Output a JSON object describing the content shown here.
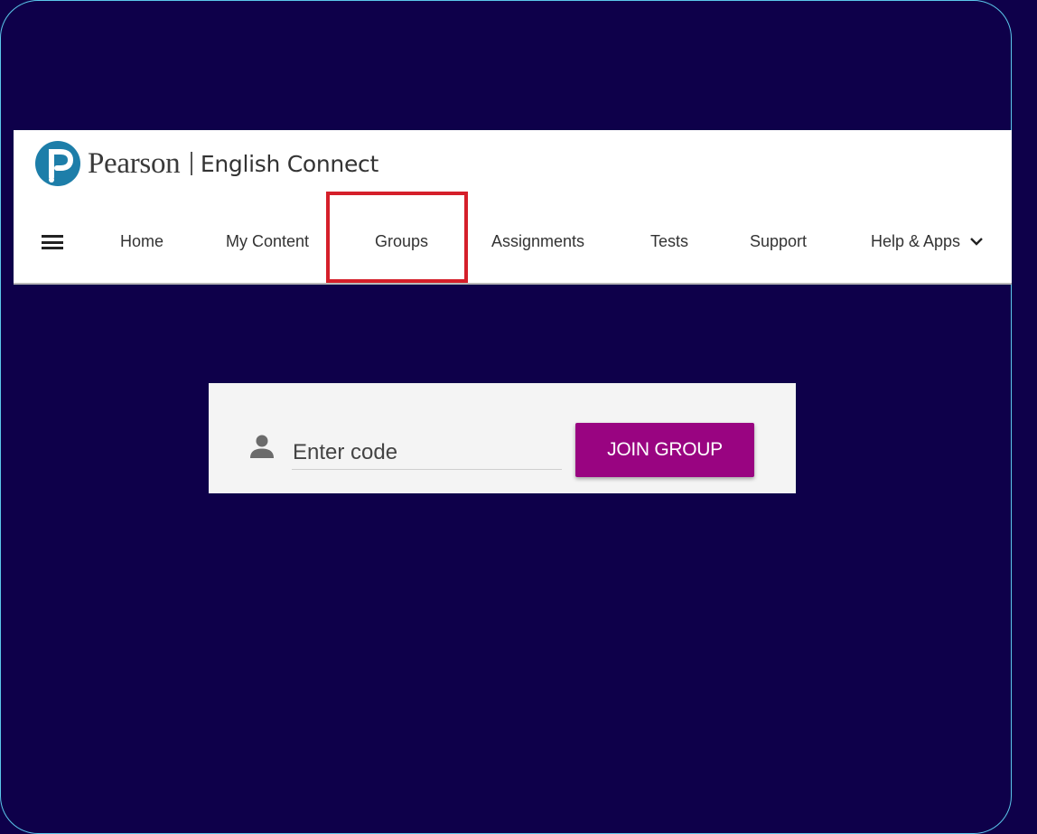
{
  "brand": {
    "name": "Pearson",
    "product": "English Connect",
    "logo_color": "#1d7ea9"
  },
  "nav": {
    "menu_icon": "hamburger-menu-icon",
    "items": [
      {
        "label": "Home"
      },
      {
        "label": "My Content"
      },
      {
        "label": "Groups",
        "highlighted": true
      },
      {
        "label": "Assignments"
      },
      {
        "label": "Tests"
      },
      {
        "label": "Support"
      },
      {
        "label": "Help & Apps",
        "has_dropdown": true
      }
    ],
    "highlight_color": "#d51f2a"
  },
  "join_group": {
    "icon": "person-icon",
    "placeholder": "Enter code",
    "button_label": "JOIN GROUP",
    "button_color": "#990481"
  },
  "theme": {
    "background": "#0e004a",
    "frame_border": "#5bc8ec"
  }
}
